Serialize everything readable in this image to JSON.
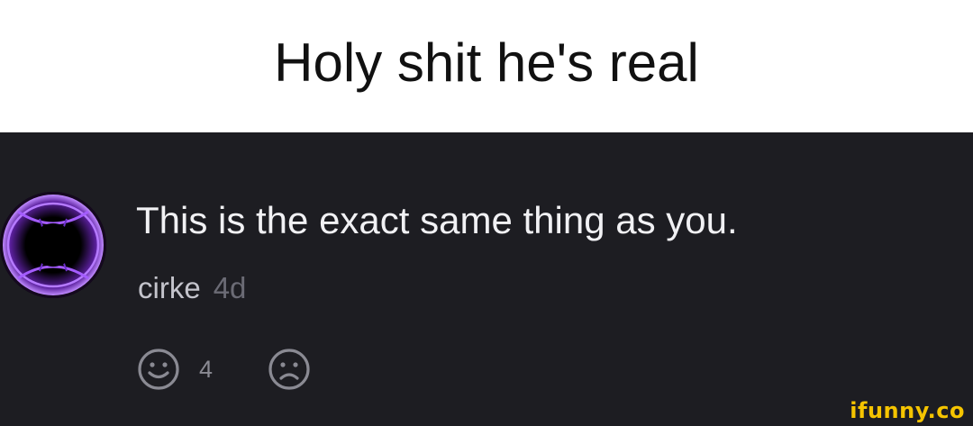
{
  "caption": {
    "text": "Holy shit he's real"
  },
  "comment": {
    "avatar_icon": "portal-orb-icon",
    "text": "This is the exact same thing as you.",
    "username": "cirke",
    "timestamp": "4d",
    "actions": {
      "like_icon": "smile-icon",
      "like_count": "4",
      "dislike_icon": "frown-icon"
    }
  },
  "watermark": {
    "text": "ifunny.co"
  },
  "colors": {
    "panel_bg": "#1d1d22",
    "comment_text": "#f1f1f4",
    "username": "#c4c4cc",
    "timestamp": "#6b6b75",
    "icon": "#8a8a93",
    "watermark": "#f5c400",
    "avatar_glow": "#9b4dff"
  }
}
